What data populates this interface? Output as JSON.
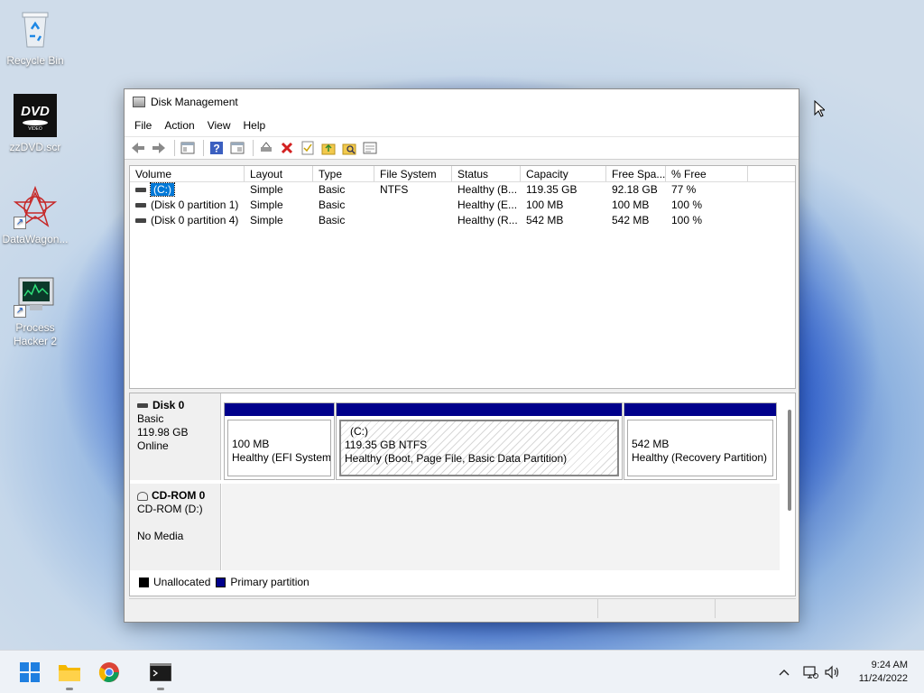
{
  "desktop": {
    "icons": [
      {
        "label": "Recycle Bin",
        "icon": "recycle-bin-icon"
      },
      {
        "label": "zzDVD.scr",
        "icon": "dvd-icon"
      },
      {
        "label": "DataWagon...",
        "icon": "datawagon-icon"
      },
      {
        "label": "Process Hacker 2",
        "icon": "process-hacker-icon"
      }
    ]
  },
  "window": {
    "title": "Disk Management",
    "menu": [
      "File",
      "Action",
      "View",
      "Help"
    ],
    "toolbar_icons": [
      "back-icon",
      "forward-icon",
      "show-hide-icon",
      "help-icon",
      "properties-icon",
      "connect-icon",
      "delete-icon",
      "check-icon",
      "open-icon",
      "explore-icon",
      "settings-icon"
    ],
    "volume_columns": [
      "Volume",
      "Layout",
      "Type",
      "File System",
      "Status",
      "Capacity",
      "Free Spa...",
      "% Free"
    ],
    "volumes": [
      {
        "volume": "(C:)",
        "layout": "Simple",
        "type": "Basic",
        "fs": "NTFS",
        "status": "Healthy (B...",
        "capacity": "119.35 GB",
        "free": "92.18 GB",
        "pct": "77 %"
      },
      {
        "volume": "(Disk 0 partition 1)",
        "layout": "Simple",
        "type": "Basic",
        "fs": "",
        "status": "Healthy (E...",
        "capacity": "100 MB",
        "free": "100 MB",
        "pct": "100 %"
      },
      {
        "volume": "(Disk 0 partition 4)",
        "layout": "Simple",
        "type": "Basic",
        "fs": "",
        "status": "Healthy (R...",
        "capacity": "542 MB",
        "free": "542 MB",
        "pct": "100 %"
      }
    ],
    "disk0": {
      "name": "Disk 0",
      "type": "Basic",
      "size": "119.98 GB",
      "state": "Online",
      "partitions": [
        {
          "title": "",
          "line1": "100 MB",
          "line2": "Healthy (EFI System I"
        },
        {
          "title": "(C:)",
          "line1": "119.35 GB NTFS",
          "line2": "Healthy (Boot, Page File, Basic Data Partition)"
        },
        {
          "title": "",
          "line1": "542 MB",
          "line2": "Healthy (Recovery Partition)"
        }
      ]
    },
    "cdrom0": {
      "name": "CD-ROM 0",
      "drive": "CD-ROM (D:)",
      "media": "No Media"
    },
    "legend": [
      {
        "label": "Unallocated",
        "color": "#000000"
      },
      {
        "label": "Primary partition",
        "color": "#00008b"
      }
    ]
  },
  "taskbar": {
    "apps": [
      "start-icon",
      "file-explorer-icon",
      "chrome-icon",
      "terminal-icon"
    ],
    "clock_time": "9:24 AM",
    "clock_date": "11/24/2022"
  }
}
